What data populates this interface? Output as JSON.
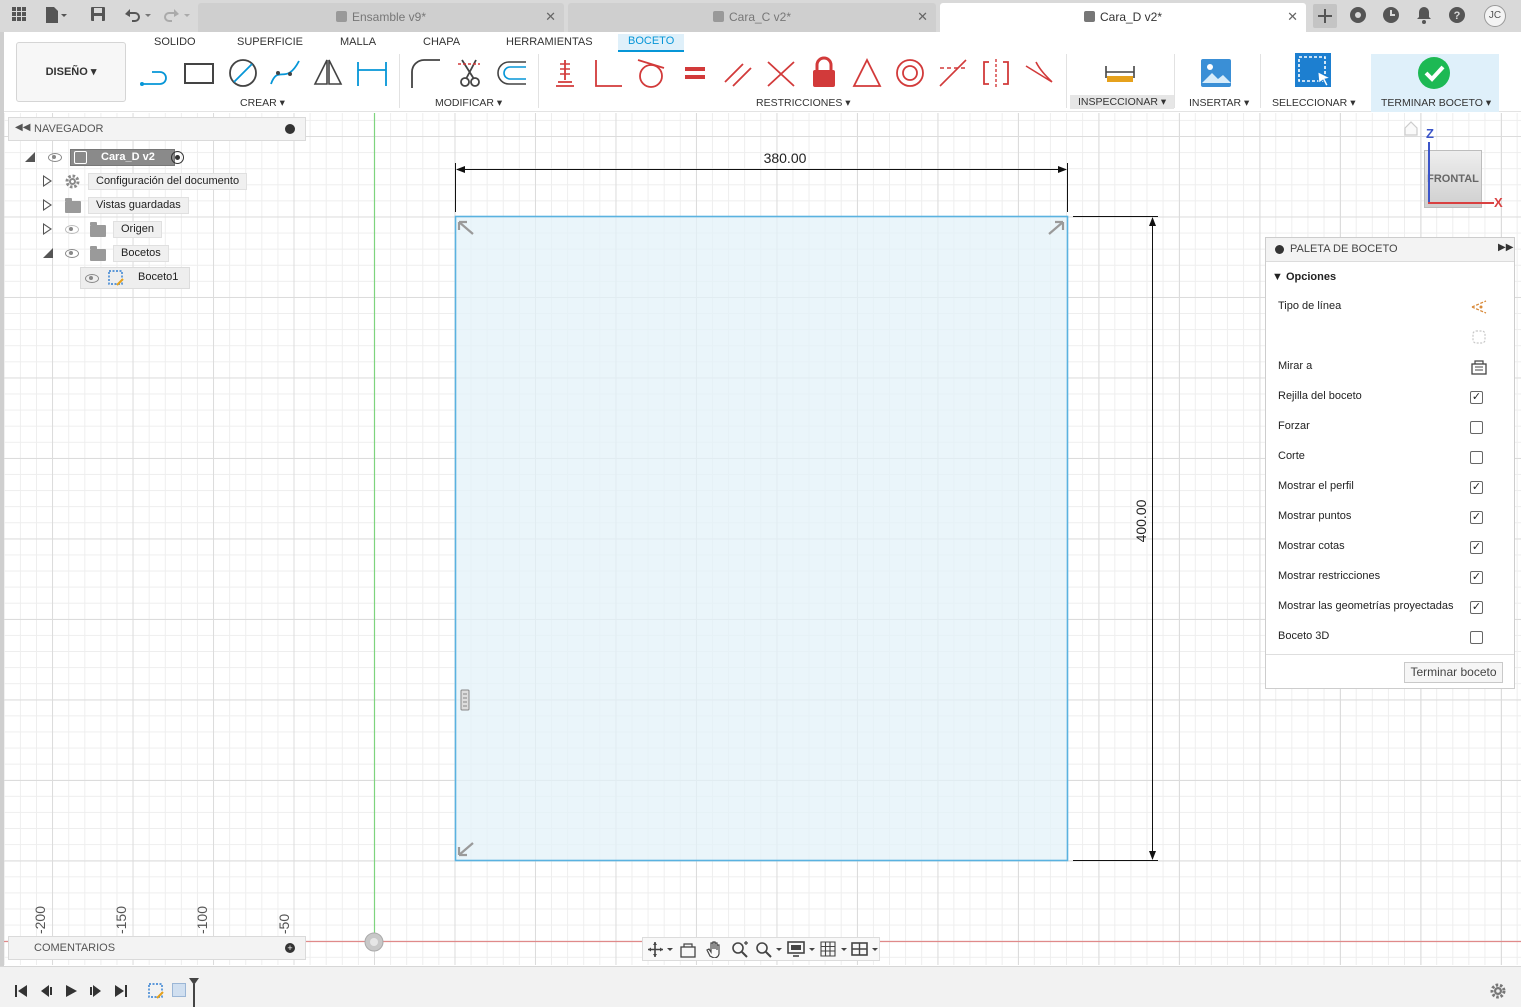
{
  "title_bar": {
    "tabs": [
      {
        "label": "Ensamble v9*",
        "active": false
      },
      {
        "label": "Cara_C v2*",
        "active": false
      },
      {
        "label": "Cara_D v2*",
        "active": true
      }
    ],
    "user_initials": "JC",
    "icons": [
      "apps-grid-icon",
      "file-icon",
      "save-icon",
      "undo-icon",
      "redo-icon",
      "close-icon",
      "add-tab-icon",
      "extensions-icon",
      "job-status-icon",
      "notifications-icon",
      "help-icon"
    ]
  },
  "ribbon": {
    "workspace_button": "DISEÑO",
    "tabs": [
      "SOLIDO",
      "SUPERFICIE",
      "MALLA",
      "CHAPA",
      "HERRAMIENTAS",
      "BOCETO"
    ],
    "active_tab": "BOCETO",
    "groups": {
      "create": "CREAR",
      "modify": "MODIFICAR",
      "constraints": "RESTRICCIONES",
      "inspect": "INSPECCIONAR",
      "insert": "INSERTAR",
      "select": "SELECCIONAR",
      "finish": "TERMINAR BOCETO"
    },
    "accent_color": "#0696d7",
    "finish_color": "#1db954"
  },
  "navigator": {
    "title": "NAVEGADOR",
    "root": "Cara_D v2",
    "items": [
      {
        "label": "Configuración del documento"
      },
      {
        "label": "Vistas guardadas"
      },
      {
        "label": "Origen"
      },
      {
        "label": "Bocetos"
      },
      {
        "label": "Boceto1"
      }
    ]
  },
  "comments": {
    "title": "COMENTARIOS"
  },
  "sketch": {
    "dim_horizontal": "380.00",
    "dim_vertical": "400.00",
    "ruler_ticks": [
      "-200",
      "-150",
      "-100",
      "-50"
    ],
    "fill_color": "#e3f1f8",
    "edge_color": "#5ab2e0"
  },
  "viewcube": {
    "face": "FRONTAL",
    "axis_z": "Z",
    "axis_x": "X"
  },
  "palette": {
    "title": "PALETA DE BOCETO",
    "section": "Opciones",
    "rows": [
      {
        "label": "Tipo de línea",
        "kind": "icon",
        "icon": "linetype-icon"
      },
      {
        "label": "",
        "kind": "icon",
        "icon": "construction-icon"
      },
      {
        "label": "Mirar a",
        "kind": "icon",
        "icon": "look-at-icon"
      },
      {
        "label": "Rejilla del boceto",
        "kind": "check",
        "checked": true
      },
      {
        "label": "Forzar",
        "kind": "check",
        "checked": false
      },
      {
        "label": "Corte",
        "kind": "check",
        "checked": false
      },
      {
        "label": "Mostrar el perfil",
        "kind": "check",
        "checked": true
      },
      {
        "label": "Mostrar puntos",
        "kind": "check",
        "checked": true
      },
      {
        "label": "Mostrar cotas",
        "kind": "check",
        "checked": true
      },
      {
        "label": "Mostrar restricciones",
        "kind": "check",
        "checked": true
      },
      {
        "label": "Mostrar las geometrías proyectadas",
        "kind": "check",
        "checked": true
      },
      {
        "label": "Boceto 3D",
        "kind": "check",
        "checked": false
      }
    ],
    "finish_button": "Terminar boceto"
  }
}
